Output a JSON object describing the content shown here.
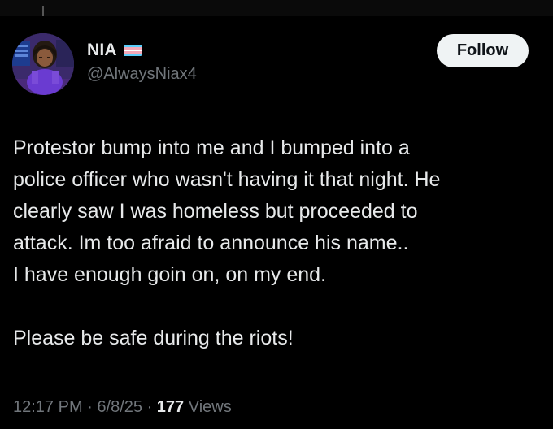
{
  "author": {
    "display_name": "NIA",
    "flag_icon": "transgender-flag-icon",
    "flag_colors": [
      "#5bcefa",
      "#f5a9b8",
      "#ffffff",
      "#f5a9b8",
      "#5bcefa"
    ],
    "handle": "@AlwaysNiax4"
  },
  "follow_button": {
    "label": "Follow"
  },
  "tweet": {
    "lines": [
      "Protestor bump into me and I bumped into a",
      "police officer who wasn't having it that night. He",
      "clearly saw I was homeless but proceeded to",
      "attack. Im too afraid to announce his name..",
      "I have enough goin on, on my end."
    ],
    "closing_line": "Please be safe during the riots!"
  },
  "meta": {
    "time": "12:17 PM",
    "date": "6/8/25",
    "views_count": "177",
    "views_label": "Views"
  }
}
